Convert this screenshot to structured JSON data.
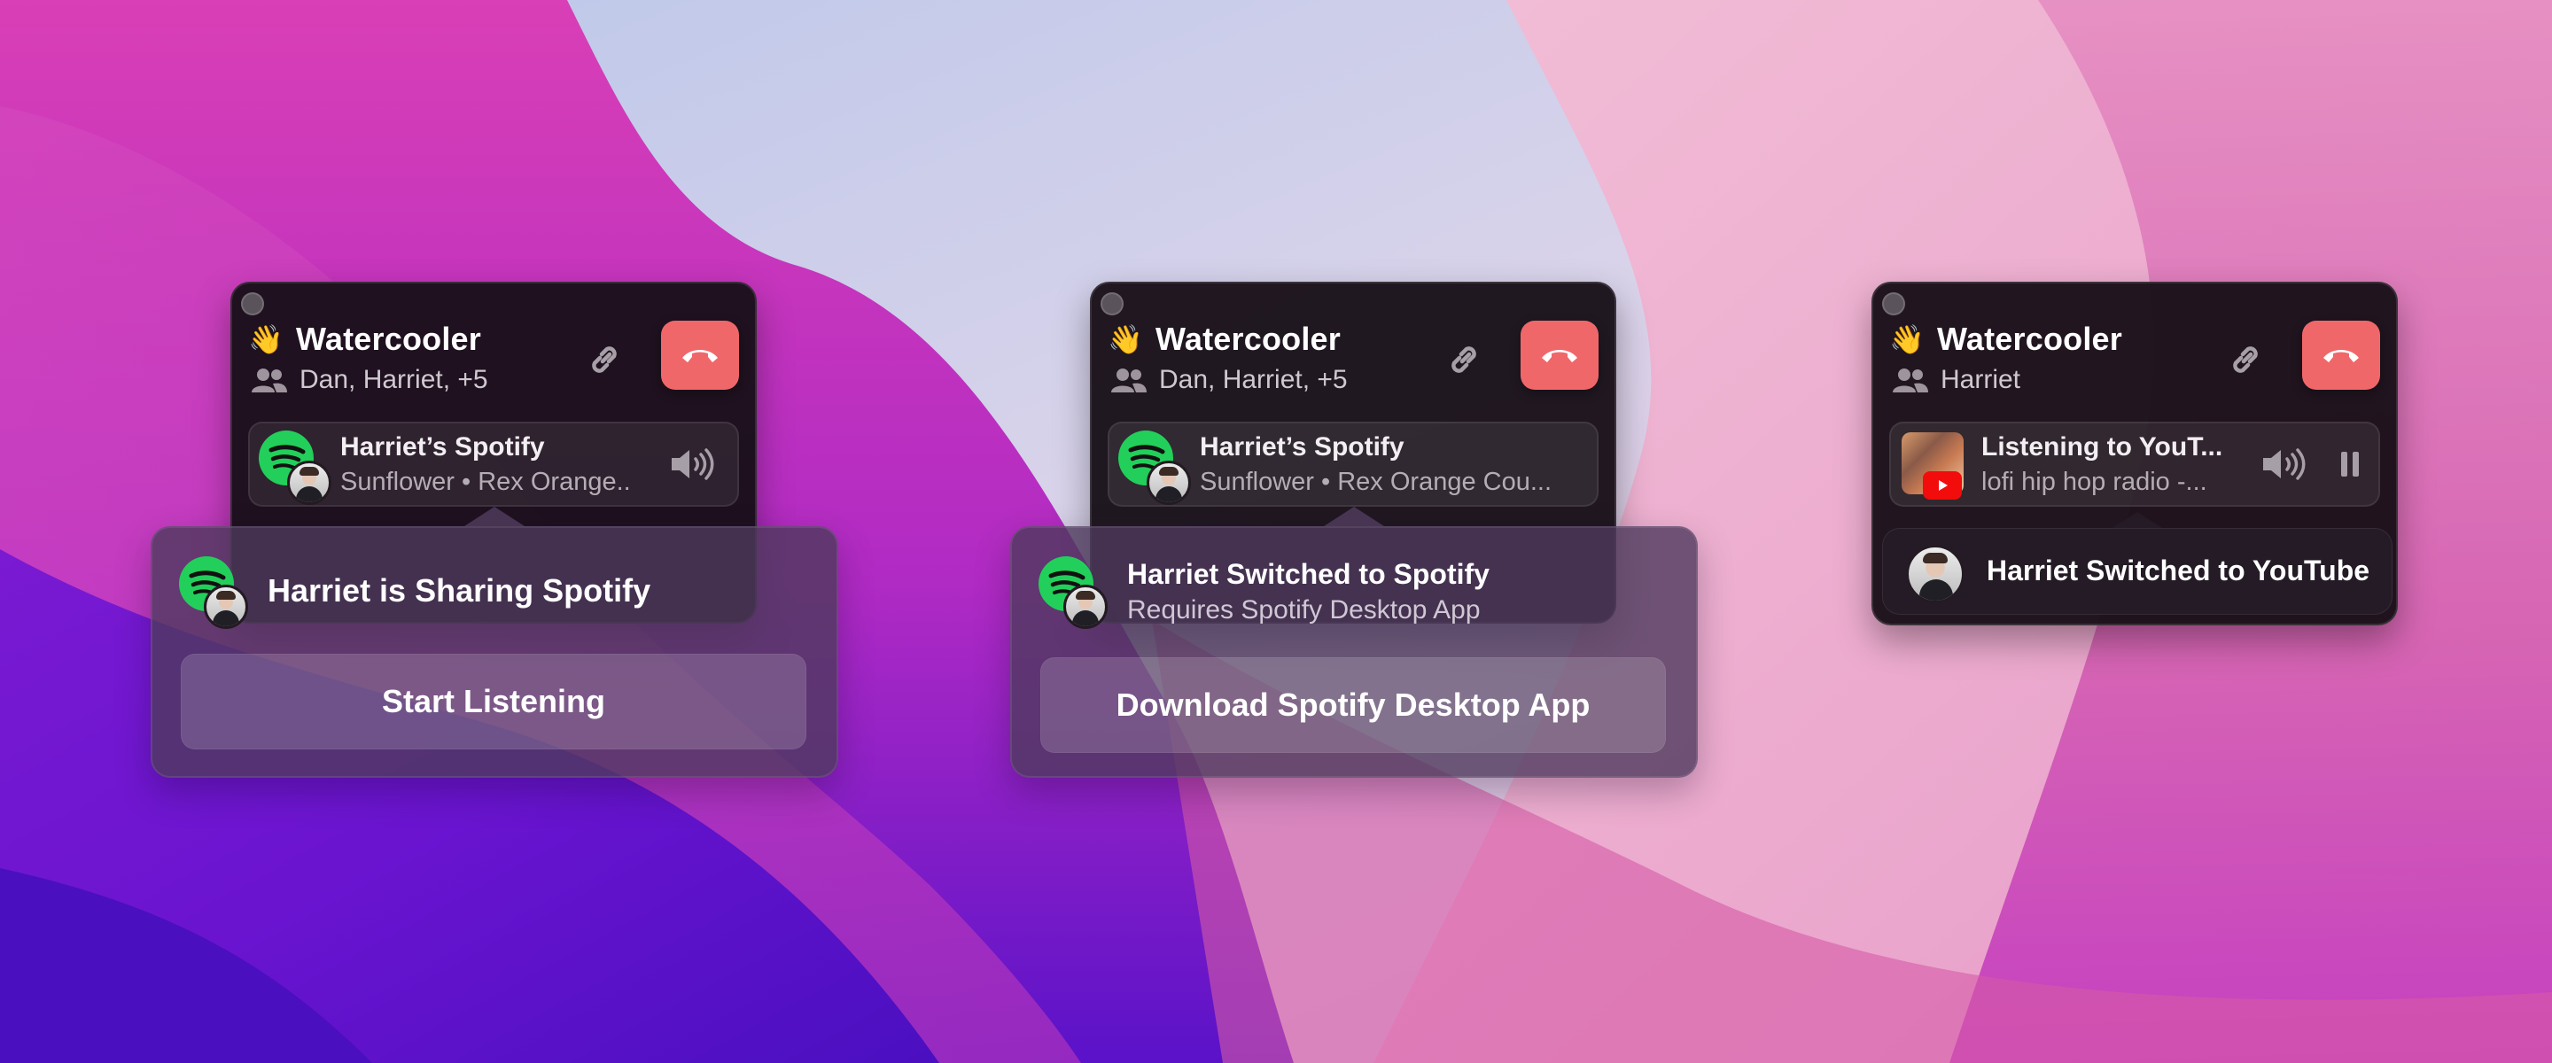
{
  "panels": [
    {
      "room": {
        "emoji": "👋",
        "title": "Watercooler",
        "participants": "Dan, Harriet, +5"
      },
      "now_playing": {
        "title": "Harriet’s Spotify",
        "subtitle": "Sunflower • Rex Orange.."
      },
      "popover": {
        "title": "Harriet is Sharing Spotify",
        "button": "Start Listening"
      }
    },
    {
      "room": {
        "emoji": "👋",
        "title": "Watercooler",
        "participants": "Dan, Harriet, +5"
      },
      "now_playing": {
        "title": "Harriet’s Spotify",
        "subtitle": "Sunflower • Rex Orange Cou..."
      },
      "popover": {
        "title": "Harriet Switched to Spotify",
        "subtitle": "Requires Spotify Desktop App",
        "button": "Download Spotify Desktop App"
      }
    },
    {
      "room": {
        "emoji": "👋",
        "title": "Watercooler",
        "participants": "Harriet"
      },
      "now_playing": {
        "title": "Listening to YouT...",
        "subtitle": "lofi hip hop radio -..."
      },
      "toast": {
        "text": "Harriet Switched to YouTube"
      }
    }
  ],
  "icons": {
    "link": "link-icon",
    "hangup": "phone-hangup-icon",
    "people": "people-icon",
    "volume": "speaker-volume-icon",
    "pause": "pause-icon",
    "spotify": "spotify-icon",
    "youtube": "youtube-icon"
  },
  "colors": {
    "hangup": "#f0676a",
    "spotify": "#22cf5a",
    "youtube": "#f20c0c"
  }
}
